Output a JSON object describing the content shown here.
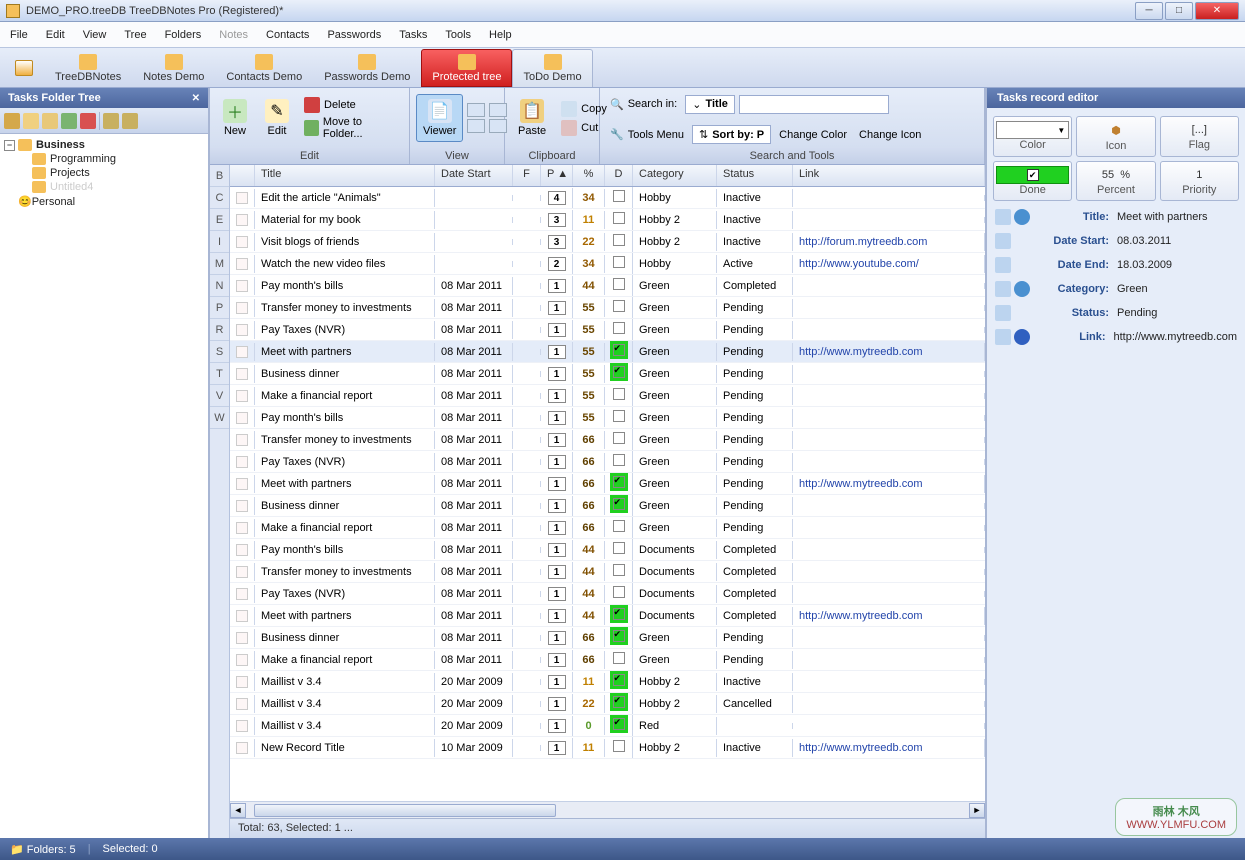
{
  "window": {
    "title": "DEMO_PRO.treeDB TreeDBNotes Pro (Registered)*"
  },
  "menu": [
    "File",
    "Edit",
    "View",
    "Tree",
    "Folders",
    "Notes",
    "Contacts",
    "Passwords",
    "Tasks",
    "Tools",
    "Help"
  ],
  "menu_disabled_index": 5,
  "tabs": [
    {
      "label": "",
      "cls": "home"
    },
    {
      "label": "TreeDBNotes"
    },
    {
      "label": "Notes Demo"
    },
    {
      "label": "Contacts Demo"
    },
    {
      "label": "Passwords Demo"
    },
    {
      "label": "Protected tree",
      "cls": "protected"
    },
    {
      "label": "ToDo Demo",
      "cls": "todo"
    }
  ],
  "tree_panel": {
    "title": "Tasks Folder Tree",
    "items": [
      {
        "label": "Business",
        "level": 0,
        "bold": true
      },
      {
        "label": "Programming",
        "level": 1
      },
      {
        "label": "Projects",
        "level": 1
      },
      {
        "label": "Untitled4",
        "level": 1,
        "muted": true
      },
      {
        "label": "Personal",
        "level": 0,
        "icon": "smiley"
      }
    ]
  },
  "ribbon": {
    "edit": {
      "new": "New",
      "edit": "Edit",
      "delete": "Delete",
      "move": "Move to Folder...",
      "label": "Edit"
    },
    "view": {
      "viewer": "Viewer",
      "label": "View"
    },
    "clip": {
      "paste": "Paste",
      "copy": "Copy",
      "cut": "Cut",
      "label": "Clipboard"
    },
    "search": {
      "searchin": "Search in:",
      "combo": "Title",
      "tools": "Tools Menu",
      "sortby": "Sort by: P",
      "changecolor": "Change Color",
      "changeicon": "Change Icon",
      "label": "Search and Tools"
    }
  },
  "columns": {
    "title": "Title",
    "date": "Date Start",
    "f": "F",
    "p": "P",
    "pct": "%",
    "d": "D",
    "cat": "Category",
    "stat": "Status",
    "link": "Link"
  },
  "alpha": [
    "B",
    "C",
    "E",
    "I",
    "M",
    "N",
    "P",
    "R",
    "S",
    "T",
    "V",
    "W"
  ],
  "rows": [
    {
      "title": "Edit the article \"Animals\"",
      "date": "",
      "p": 4,
      "pct": 34,
      "cat": "Hobby",
      "stat": "Inactive",
      "link": "",
      "d": false
    },
    {
      "title": "Material for my book",
      "date": "",
      "p": 3,
      "pct": 11,
      "cat": "Hobby 2",
      "stat": "Inactive",
      "link": "",
      "d": false
    },
    {
      "title": "Visit blogs of friends",
      "date": "",
      "p": 3,
      "pct": 22,
      "cat": "Hobby 2",
      "stat": "Inactive",
      "link": "http://forum.mytreedb.com",
      "d": false
    },
    {
      "title": "Watch the new video files",
      "date": "",
      "p": 2,
      "pct": 34,
      "cat": "Hobby",
      "stat": "Active",
      "link": "http://www.youtube.com/",
      "d": false
    },
    {
      "title": "Pay month's bills",
      "date": "08 Mar 2011",
      "p": 1,
      "pct": 44,
      "cat": "Green",
      "stat": "Completed",
      "link": "",
      "d": false
    },
    {
      "title": "Transfer money to investments",
      "date": "08 Mar 2011",
      "p": 1,
      "pct": 55,
      "cat": "Green",
      "stat": "Pending",
      "link": "",
      "d": false
    },
    {
      "title": "Pay Taxes (NVR)",
      "date": "08 Mar 2011",
      "p": 1,
      "pct": 55,
      "cat": "Green",
      "stat": "Pending",
      "link": "",
      "d": false
    },
    {
      "title": "Meet with partners",
      "date": "08 Mar 2011",
      "p": 1,
      "pct": 55,
      "cat": "Green",
      "stat": "Pending",
      "link": "http://www.mytreedb.com",
      "d": true,
      "selected": true
    },
    {
      "title": "Business dinner",
      "date": "08 Mar 2011",
      "p": 1,
      "pct": 55,
      "cat": "Green",
      "stat": "Pending",
      "link": "",
      "d": true
    },
    {
      "title": "Make a financial report",
      "date": "08 Mar 2011",
      "p": 1,
      "pct": 55,
      "cat": "Green",
      "stat": "Pending",
      "link": "",
      "d": false
    },
    {
      "title": "Pay month's bills",
      "date": "08 Mar 2011",
      "p": 1,
      "pct": 55,
      "cat": "Green",
      "stat": "Pending",
      "link": "",
      "d": false
    },
    {
      "title": "Transfer money to investments",
      "date": "08 Mar 2011",
      "p": 1,
      "pct": 66,
      "cat": "Green",
      "stat": "Pending",
      "link": "",
      "d": false
    },
    {
      "title": "Pay Taxes (NVR)",
      "date": "08 Mar 2011",
      "p": 1,
      "pct": 66,
      "cat": "Green",
      "stat": "Pending",
      "link": "",
      "d": false
    },
    {
      "title": "Meet with partners",
      "date": "08 Mar 2011",
      "p": 1,
      "pct": 66,
      "cat": "Green",
      "stat": "Pending",
      "link": "http://www.mytreedb.com",
      "d": true
    },
    {
      "title": "Business dinner",
      "date": "08 Mar 2011",
      "p": 1,
      "pct": 66,
      "cat": "Green",
      "stat": "Pending",
      "link": "",
      "d": true
    },
    {
      "title": "Make a financial report",
      "date": "08 Mar 2011",
      "p": 1,
      "pct": 66,
      "cat": "Green",
      "stat": "Pending",
      "link": "",
      "d": false
    },
    {
      "title": "Pay month's bills",
      "date": "08 Mar 2011",
      "p": 1,
      "pct": 44,
      "cat": "Documents",
      "stat": "Completed",
      "link": "",
      "d": false
    },
    {
      "title": "Transfer money to investments",
      "date": "08 Mar 2011",
      "p": 1,
      "pct": 44,
      "cat": "Documents",
      "stat": "Completed",
      "link": "",
      "d": false
    },
    {
      "title": "Pay Taxes (NVR)",
      "date": "08 Mar 2011",
      "p": 1,
      "pct": 44,
      "cat": "Documents",
      "stat": "Completed",
      "link": "",
      "d": false
    },
    {
      "title": "Meet with partners",
      "date": "08 Mar 2011",
      "p": 1,
      "pct": 44,
      "cat": "Documents",
      "stat": "Completed",
      "link": "http://www.mytreedb.com",
      "d": true
    },
    {
      "title": "Business dinner",
      "date": "08 Mar 2011",
      "p": 1,
      "pct": 66,
      "cat": "Green",
      "stat": "Pending",
      "link": "",
      "d": true
    },
    {
      "title": "Make a financial report",
      "date": "08 Mar 2011",
      "p": 1,
      "pct": 66,
      "cat": "Green",
      "stat": "Pending",
      "link": "",
      "d": false
    },
    {
      "title": "Maillist v 3.4",
      "date": "20 Mar 2009",
      "p": 1,
      "pct": 11,
      "cat": "Hobby 2",
      "stat": "Inactive",
      "link": "",
      "d": true
    },
    {
      "title": "Maillist v 3.4",
      "date": "20 Mar 2009",
      "p": 1,
      "pct": 22,
      "cat": "Hobby 2",
      "stat": "Cancelled",
      "link": "",
      "d": true
    },
    {
      "title": "Maillist v 3.4",
      "date": "20 Mar 2009",
      "p": 1,
      "pct": 0,
      "cat": "Red",
      "stat": "",
      "link": "",
      "d": true
    },
    {
      "title": "New Record Title",
      "date": "10 Mar 2009",
      "p": 1,
      "pct": 11,
      "cat": "Hobby 2",
      "stat": "Inactive",
      "link": "http://www.mytreedb.com",
      "d": false
    }
  ],
  "footer": {
    "total": "Total: 63, Selected: 1 ..."
  },
  "editor": {
    "title_panel": "Tasks record editor",
    "btn1": {
      "label": "Color"
    },
    "btn2": {
      "label": "Icon"
    },
    "btn3": {
      "label": "Flag",
      "val": "[...]"
    },
    "btn4": {
      "label": "Done",
      "checked": true
    },
    "btn5": {
      "label": "Percent",
      "val": "55",
      "unit": "%"
    },
    "btn6": {
      "label": "Priority",
      "val": "1"
    },
    "fields": [
      {
        "label": "Title:",
        "val": "Meet with partners",
        "search": true
      },
      {
        "label": "Date Start:",
        "val": "08.03.2011"
      },
      {
        "label": "Date End:",
        "val": "18.03.2009"
      },
      {
        "label": "Category:",
        "val": "Green",
        "search": true
      },
      {
        "label": "Status:",
        "val": "Pending"
      },
      {
        "label": "Link:",
        "val": "http://www.mytreedb.com",
        "globe": true
      }
    ]
  },
  "status": {
    "folders": "Folders: 5",
    "selected": "Selected: 0"
  },
  "watermark": {
    "cn": "雨林 木风",
    "url": "WWW.YLMFU.COM"
  }
}
